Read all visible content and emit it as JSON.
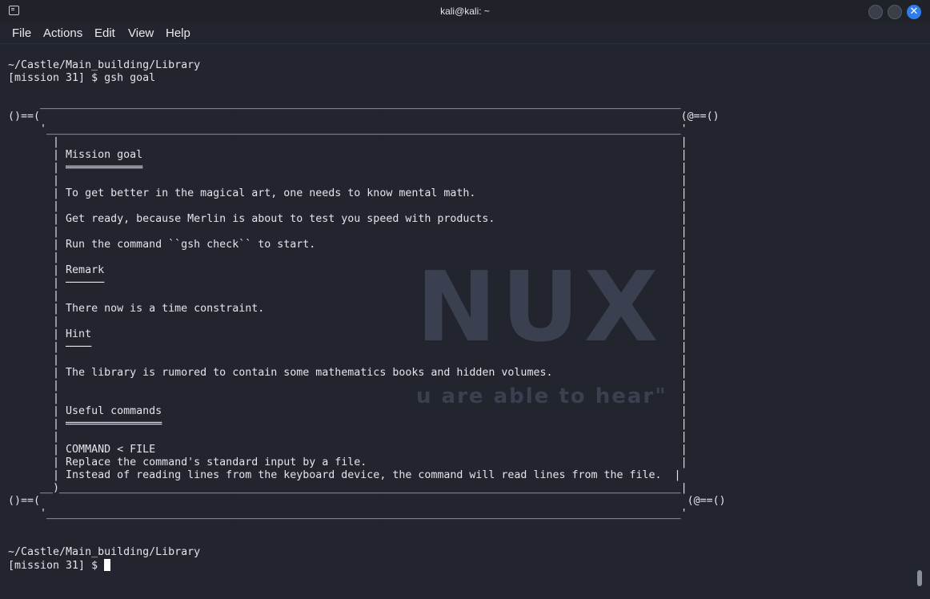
{
  "window": {
    "title": "kali@kali: ~"
  },
  "menu": [
    "File",
    "Actions",
    "Edit",
    "View",
    "Help"
  ],
  "icons": {
    "app": "terminal-icon",
    "minimize": "minimize-icon",
    "maximize": "maximize-icon",
    "close": "close-icon"
  },
  "colors": {
    "close_button": "#2f7dea",
    "background": "#22252e",
    "text": "#e3e5ea"
  },
  "terminal": {
    "lines": [
      "~/Castle/Main_building/Library",
      "[mission 31] $ gsh goal",
      "",
      "     ____________________________________________________________________________________________________",
      "()==(                                                                                                    (@==()",
      "     '___________________________________________________________________________________________________'",
      "       |                                                                                                 |",
      "       | Mission goal                                                                                    |",
      "       | ════════════                                                                                    |",
      "       |                                                                                                 |",
      "       | To get better in the magical art, one needs to know mental math.                                |",
      "       |                                                                                                 |",
      "       | Get ready, because Merlin is about to test you speed with products.                             |",
      "       |                                                                                                 |",
      "       | Run the command ``gsh check`` to start.                                                         |",
      "       |                                                                                                 |",
      "       | Remark                                                                                          |",
      "       | ──────                                                                                          |",
      "       |                                                                                                 |",
      "       | There now is a time constraint.                                                                 |",
      "       |                                                                                                 |",
      "       | Hint                                                                                            |",
      "       | ────                                                                                            |",
      "       |                                                                                                 |",
      "       | The library is rumored to contain some mathematics books and hidden volumes.                    |",
      "       |                                                                                                 |",
      "       |                                                                                                 |",
      "       | Useful commands                                                                                 |",
      "       | ═══════════════                                                                                 |",
      "       |                                                                                                 |",
      "       | COMMAND < FILE                                                                                  |",
      "       | Replace the command's standard input by a file.                                                 |",
      "       | Instead of reading lines from the keyboard device, the command will read lines from the file.  |",
      "     __)_________________________________________________________________________________________________|",
      "()==(                                                                                                     (@==()",
      "     '___________________________________________________________________________________________________'",
      "",
      "",
      "~/Castle/Main_building/Library"
    ],
    "prompt": "[mission 31] $ "
  },
  "wallpaper": {
    "logo": "NUX",
    "tagline": "u are able to hear\""
  }
}
